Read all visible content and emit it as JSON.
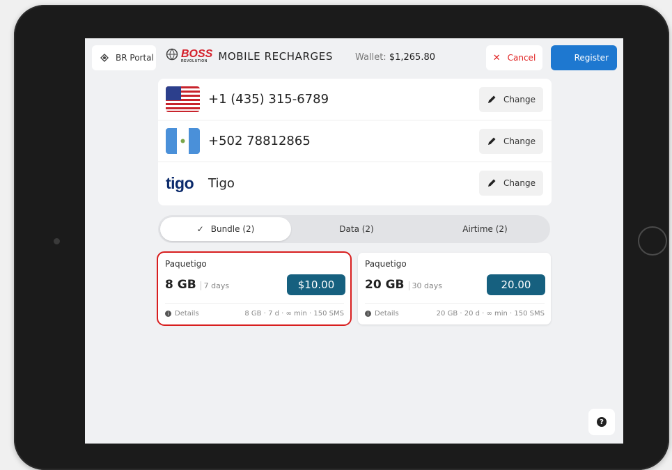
{
  "header": {
    "portal_label": "BR Portal",
    "brand_name": "BOSS",
    "brand_sub": "REVOLUTION",
    "app_title": "MOBILE RECHARGES",
    "wallet_label": "Wallet:",
    "wallet_amount": "$1,265.80",
    "cancel_label": "Cancel",
    "register_label": "Register"
  },
  "contacts": [
    {
      "icon": "us-flag-icon",
      "text": "+1 (435) 315-6789",
      "change_label": "Change"
    },
    {
      "icon": "guatemala-flag-icon",
      "text": "+502 78812865",
      "change_label": "Change"
    },
    {
      "icon": "tigo-logo-icon",
      "logo_text": "tigo",
      "text": "Tigo",
      "change_label": "Change"
    }
  ],
  "tabs": [
    {
      "label": "Bundle (2)",
      "active": true
    },
    {
      "label": "Data (2)",
      "active": false
    },
    {
      "label": "Airtime (2)",
      "active": false
    }
  ],
  "bundles": [
    {
      "name": "Paquetigo",
      "size": "8 GB",
      "duration": "7 days",
      "price": "$10.00",
      "details_label": "Details",
      "summary": "8 GB · 7 d · ∞ min · 150 SMS",
      "selected": true
    },
    {
      "name": "Paquetigo",
      "size": "20 GB",
      "duration": "30 days",
      "price": "20.00",
      "details_label": "Details",
      "summary": "20 GB · 20 d · ∞ min · 150 SMS",
      "selected": false
    }
  ],
  "colors": {
    "accent_blue": "#1e78d0",
    "price_button": "#16607f",
    "cancel_red": "#e02020",
    "selection_outline": "#d81e1e"
  }
}
